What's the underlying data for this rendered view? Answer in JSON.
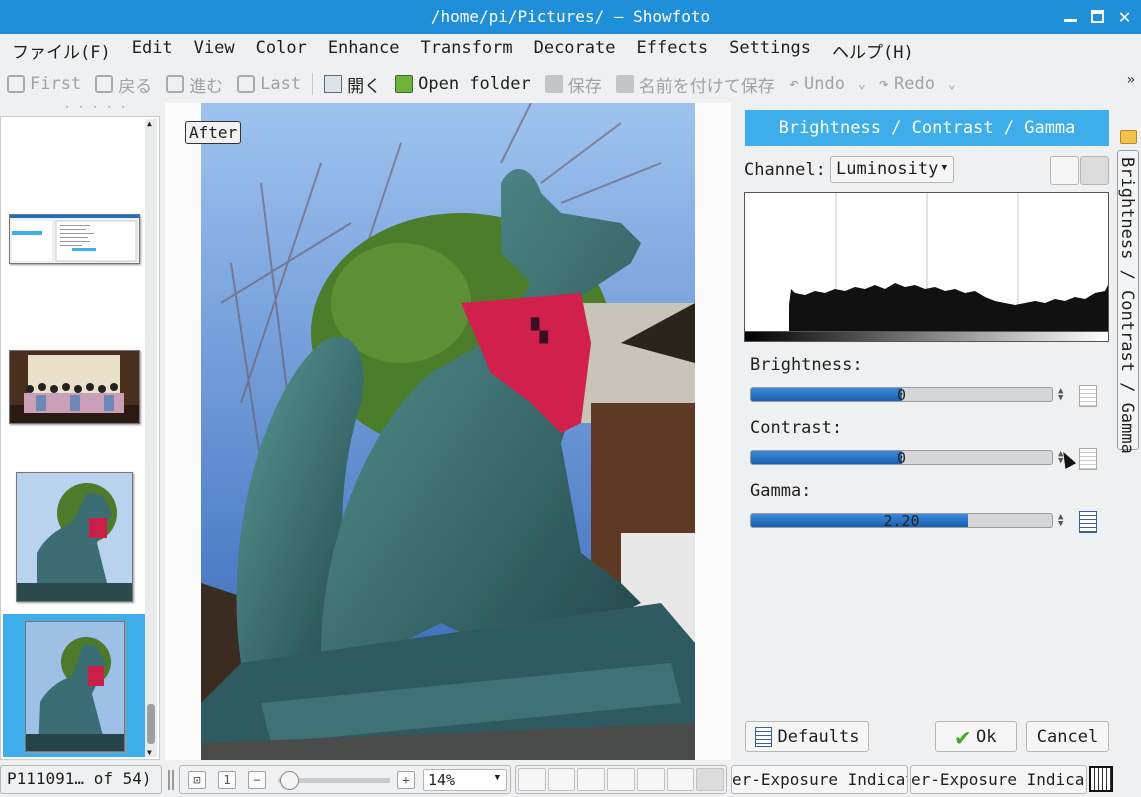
{
  "window": {
    "title": "/home/pi/Pictures/ — Showfoto"
  },
  "menu": [
    "ファイル(F)",
    "Edit",
    "View",
    "Color",
    "Enhance",
    "Transform",
    "Decorate",
    "Effects",
    "Settings",
    "ヘルプ(H)"
  ],
  "toolbar": {
    "first": "First",
    "back": "戻る",
    "forward": "進む",
    "last": "Last",
    "open": "開く",
    "open_folder": "Open folder",
    "save": "保存",
    "save_as": "名前を付けて保存",
    "undo": "Undo",
    "redo": "Redo",
    "more": "»"
  },
  "canvas": {
    "overlay_label": "After"
  },
  "tool_panel": {
    "header": "Brightness / Contrast / Gamma",
    "channel_label": "Channel:",
    "channel_value": "Luminosity",
    "brightness_label": "Brightness:",
    "brightness_value": "0",
    "brightness_fill": 0.5,
    "contrast_label": "Contrast:",
    "contrast_value": "0",
    "contrast_fill": 0.5,
    "gamma_label": "Gamma:",
    "gamma_value": "2.20",
    "gamma_fill": 0.72,
    "defaults_button": "Defaults",
    "ok_button": "Ok",
    "cancel_button": "Cancel",
    "side_tab": "Brightness / Contrast / Gamma"
  },
  "statusbar": {
    "file_info": "P111091… of 54)",
    "zoom": "14%",
    "indicator1": "er-Exposure Indicat",
    "indicator2": "er-Exposure Indica"
  },
  "colors": {
    "accent": "#3daee9",
    "titlebar": "#1e8fd8",
    "slider_fill": "#1a5fb0"
  }
}
